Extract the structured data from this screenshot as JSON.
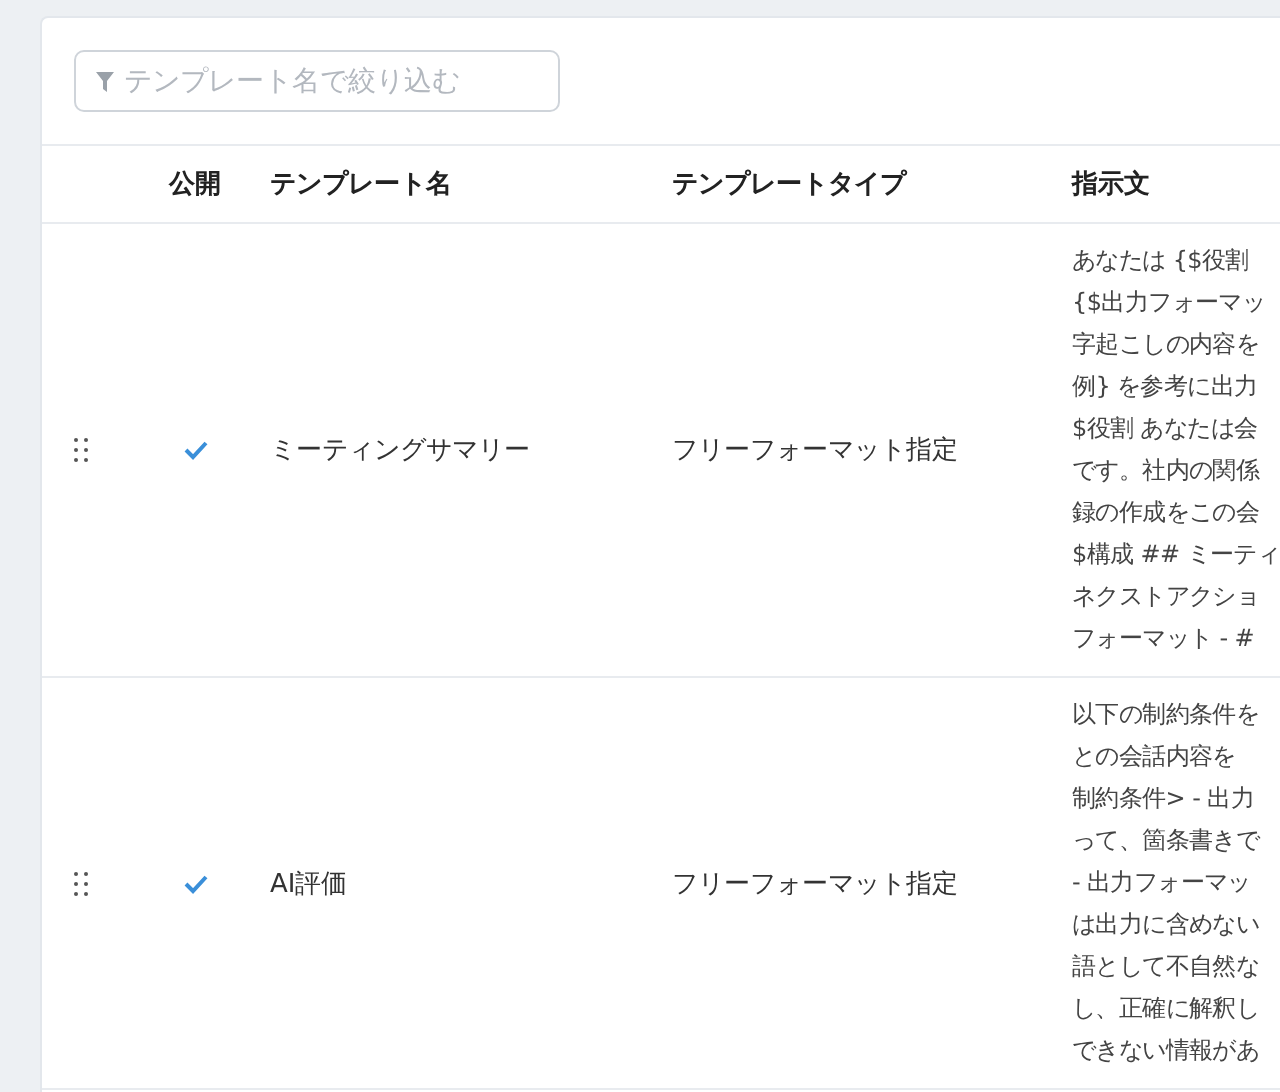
{
  "filter": {
    "placeholder": "テンプレート名で絞り込む"
  },
  "columns": [
    "公開",
    "テンプレート名",
    "テンプレートタイプ",
    "指示文"
  ],
  "rows": [
    {
      "published": true,
      "name": "ミーティングサマリー",
      "type": "フリーフォーマット指定",
      "instruction_lines": [
        "あなたは {$役割",
        "{$出力フォーマッ",
        "字起こしの内容を",
        "例} を参考に出力",
        "$役割 あなたは会",
        "です。社内の関係",
        "録の作成をこの会",
        "$構成 ## ミーティ",
        "ネクストアクショ",
        "フォーマット - #"
      ]
    },
    {
      "published": true,
      "name": "AI評価",
      "type": "フリーフォーマット指定",
      "instruction_lines": [
        "以下の制約条件を",
        "との会話内容を",
        "制約条件> - 出力",
        "って、箇条書きで",
        "- 出力フォーマッ",
        "は出力に含めない",
        "語として不自然な",
        "し、正確に解釈し",
        "できない情報があ"
      ]
    }
  ]
}
